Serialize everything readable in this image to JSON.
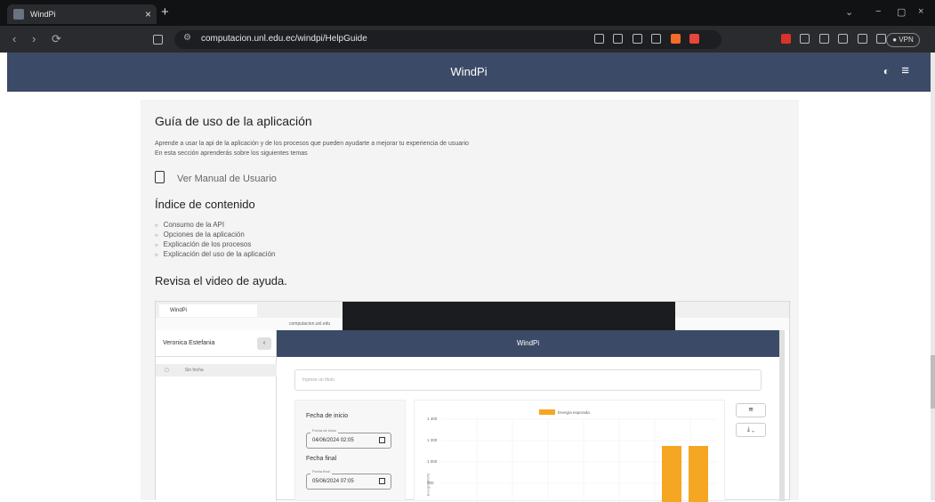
{
  "browser": {
    "tab_title": "WindPi",
    "tab_close": "×",
    "new_tab": "+",
    "url": "computacion.unl.edu.ec/windpi/HelpGuide",
    "nav_back": "‹",
    "nav_forward": "›",
    "nav_reload": "⟳",
    "win_min": "−",
    "win_max": "▢",
    "win_close": "×",
    "tab_list": "⌄",
    "vpn_label": "● VPN"
  },
  "app": {
    "title": "WindPi",
    "theme_icon": "◐",
    "menu_icon": "≡"
  },
  "guide": {
    "heading": "Guía de uso de la aplicación",
    "intro_1": "Aprende a usar la api de la aplicación y de los procesos que pueden ayudarte a mejorar tu experiencia de usuario",
    "intro_2": "En esta sección aprenderás sobre los siguientes temas",
    "manual_link": "Ver Manual de Usuario",
    "index_heading": "Índice de contenido",
    "index_items": [
      "Consumo de la API",
      "Opciones de la aplicación",
      "Explicación de los procesos",
      "Explicación del uso de la aplicación"
    ],
    "video_heading": "Revisa el video de ayuda."
  },
  "video": {
    "tab_title": "WindPi",
    "url_partial": "computacion.unl.edu",
    "sidebar_user": "Veronica Estefania",
    "sidebar_back": "‹",
    "sidebar_item": "Sin fecha",
    "app_title": "WindPi",
    "input_placeholder": "Ingrese un título",
    "start_label": "Fecha de inicio",
    "start_mini": "Fecha de inicio",
    "start_value": "04/06/2024 02:05",
    "end_label": "Fecha final",
    "end_mini": "Fecha final",
    "end_value": "05/06/2024 07:05",
    "filter_btn": "≅",
    "download_btn": "⤓ ⌄"
  },
  "chart_data": {
    "type": "bar",
    "legend": [
      "Energía esperada"
    ],
    "y_ticks": [
      "1 400",
      "1 200",
      "1 000",
      "800"
    ],
    "ylabel": "Energía (kWh)",
    "series": [
      {
        "name": "Energía esperada",
        "values": [
          1200,
          1200
        ]
      }
    ],
    "ylim": [
      700,
      1450
    ],
    "color": "#f5a623"
  }
}
